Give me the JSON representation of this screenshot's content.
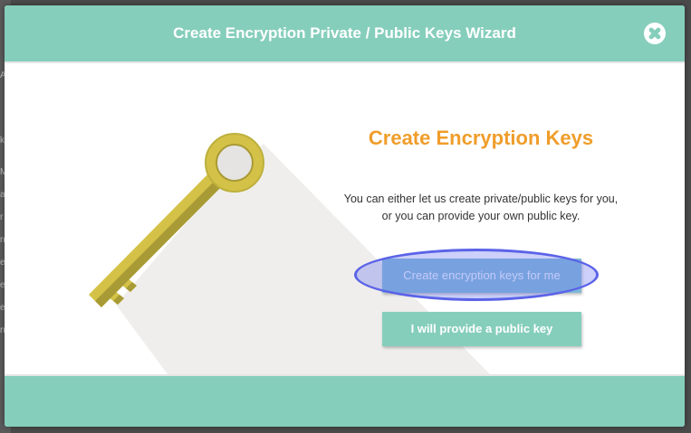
{
  "background": {
    "side_letters": [
      "m",
      "A",
      "k",
      "M",
      "a",
      "r",
      "n",
      "e",
      "e",
      "e",
      "n",
      "b"
    ]
  },
  "modal": {
    "title": "Create Encryption Private / Public Keys Wizard",
    "close_icon": "close-x-icon",
    "heading": "Create Encryption Keys",
    "description_lines": [
      "You can either let us create private/public keys for you,",
      "or you can provide your own public key."
    ],
    "buttons": {
      "create_label": "Create encryption keys for me",
      "provide_label": "I will provide a public key"
    },
    "illustration": "key-icon",
    "highlighted_button": "create_label"
  },
  "colors": {
    "header_teal": "#86cebc",
    "heading_orange": "#f09d2a",
    "key_gold": "#d4c248",
    "highlight_blue": "#5b63e8"
  }
}
